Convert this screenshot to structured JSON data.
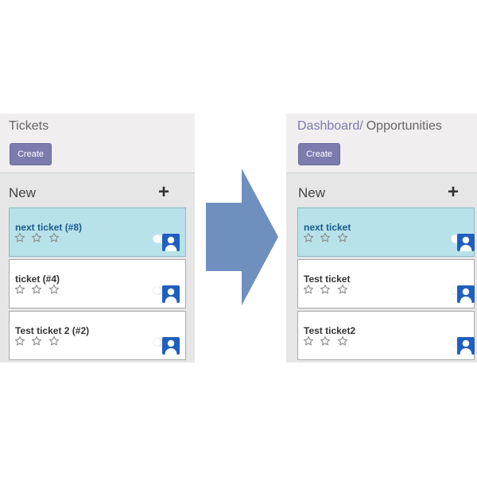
{
  "before": {
    "title": "Tickets",
    "create_label": "Create",
    "column": {
      "title": "New",
      "add_symbol": "+"
    },
    "cards": [
      {
        "title": "next ticket (#8)",
        "selected": true,
        "stars": 3
      },
      {
        "title": "ticket (#4)",
        "selected": false,
        "stars": 3
      },
      {
        "title": "Test ticket 2 (#2)",
        "selected": false,
        "stars": 3
      }
    ]
  },
  "after": {
    "breadcrumb": {
      "link": "Dashboard",
      "separator": "/",
      "current": "Opportunities"
    },
    "create_label": "Create",
    "column": {
      "title": "New",
      "add_symbol": "+"
    },
    "cards": [
      {
        "title": "next ticket",
        "selected": true,
        "stars": 3
      },
      {
        "title": "Test ticket",
        "selected": false,
        "stars": 3
      },
      {
        "title": "Test ticket2",
        "selected": false,
        "stars": 3
      }
    ]
  },
  "colors": {
    "accent": "#7c7bad",
    "selected_card": "#b8e2ea",
    "arrow": "#6f8fbf",
    "avatar": "#1f5fbf"
  },
  "icons": {
    "arrow": "right-arrow-icon",
    "star": "star-outline-icon",
    "avatar": "user-avatar-icon",
    "add": "plus-icon"
  }
}
